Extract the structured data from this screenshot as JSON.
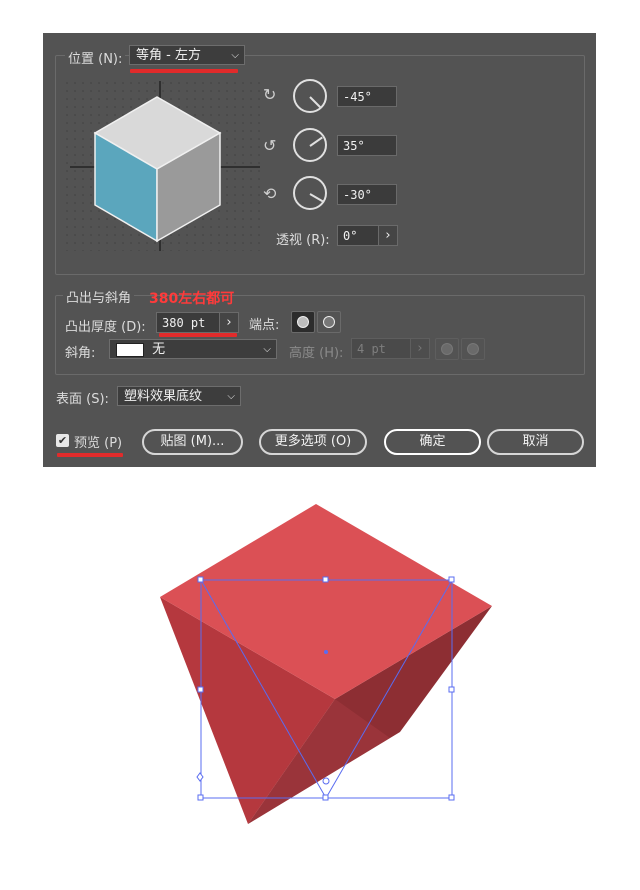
{
  "dialog": {
    "position": {
      "label": "位置 (N):",
      "selected": "等角 - 左方"
    },
    "rotation": {
      "x_value": "-45°",
      "y_value": "35°",
      "z_value": "-30°",
      "perspective_label": "透视 (R):",
      "perspective_value": "0°"
    },
    "extrude": {
      "group_label": "凸出与斜角",
      "annotation": "380左右都可",
      "depth_label": "凸出厚度 (D):",
      "depth_value": "380 pt",
      "cap_label": "端点:",
      "bevel_label": "斜角:",
      "bevel_value": "无",
      "height_label": "高度 (H):",
      "height_value": "4 pt"
    },
    "surface": {
      "label": "表面 (S):",
      "selected": "塑料效果底纹"
    },
    "buttons": {
      "preview": "预览 (P)",
      "map": "贴图 (M)...",
      "more": "更多选项 (O)",
      "ok": "确定",
      "cancel": "取消"
    }
  },
  "colors": {
    "accent_red": "#e12b2b",
    "cube_top": "#d9d9d9",
    "cube_left": "#5ba6bd",
    "cube_right": "#9a9a9a",
    "shape_top": "#db5055",
    "shape_left": "#b5383e",
    "shape_right": "#8d2e33",
    "selection": "#5a6cf0"
  }
}
